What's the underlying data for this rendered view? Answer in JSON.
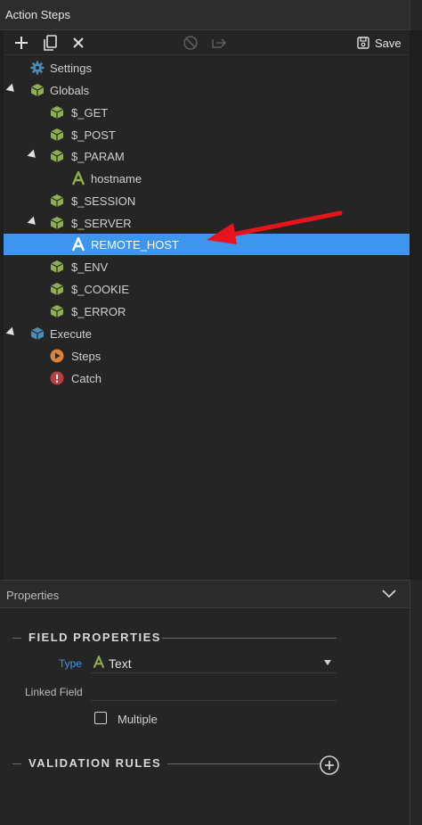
{
  "panel": {
    "title": "Action Steps"
  },
  "toolbar": {
    "save_label": "Save"
  },
  "tree": {
    "settings": "Settings",
    "globals": "Globals",
    "get": "$_GET",
    "post": "$_POST",
    "param": "$_PARAM",
    "hostname": "hostname",
    "session": "$_SESSION",
    "server": "$_SERVER",
    "remote_host": "REMOTE_HOST",
    "env": "$_ENV",
    "cookie": "$_COOKIE",
    "error": "$_ERROR",
    "execute": "Execute",
    "steps": "Steps",
    "catch": "Catch"
  },
  "properties": {
    "title": "Properties",
    "field_section": "FIELD PROPERTIES",
    "type_label": "Type",
    "type_value": "Text",
    "linked_label": "Linked Field",
    "linked_value": "",
    "multiple_label": "Multiple",
    "multiple_checked": false,
    "validation_section": "VALIDATION RULES"
  },
  "colors": {
    "selection": "#3e95ee",
    "cube_green": "#8fae4f",
    "cube_blue": "#4c8bb8",
    "steps_orange": "#d9823b",
    "catch_red": "#b84040",
    "annotation_arrow": "#e8141b"
  },
  "icons": {
    "add": "plus-icon",
    "duplicate": "copy-icon",
    "delete": "close-icon",
    "disable": "disable-icon",
    "move": "move-icon",
    "save": "save-icon",
    "cube": "cube-icon",
    "text": "text-a-icon",
    "gear": "gear-icon",
    "play": "play-circle-icon",
    "catch": "exclamation-circle-icon"
  }
}
